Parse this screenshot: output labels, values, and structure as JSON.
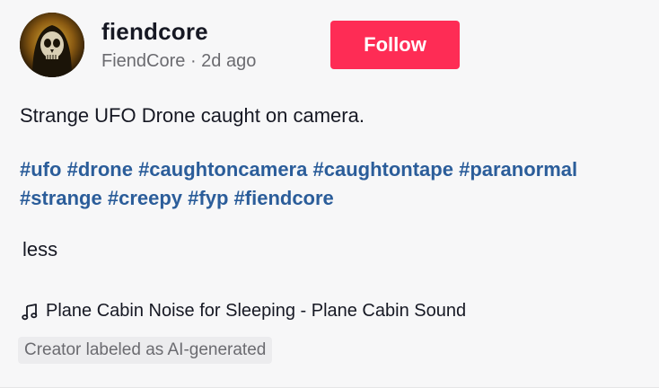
{
  "author": {
    "username": "fiendcore",
    "display_name": "FiendCore",
    "separator": " · ",
    "time_ago": "2d ago",
    "follow_label": "Follow",
    "avatar_icon": "skull-avatar-icon"
  },
  "post": {
    "caption": "Strange UFO Drone caught on camera.",
    "hashtags": [
      "#ufo",
      "#drone",
      "#caughtoncamera",
      "#caughtontape",
      "#paranormal",
      "#strange",
      "#creepy",
      "#fyp",
      "#fiendcore"
    ],
    "less_label": "less"
  },
  "music": {
    "icon": "music-note-icon",
    "title": "Plane Cabin Noise for Sleeping - Plane Cabin Sound"
  },
  "labels": {
    "ai_generated": "Creator labeled as AI-generated"
  },
  "colors": {
    "follow_button": "#fe2c55",
    "hashtag": "#2b5d9a",
    "text": "#161823",
    "muted": "#6b6b70",
    "background": "#f7f7f8"
  }
}
